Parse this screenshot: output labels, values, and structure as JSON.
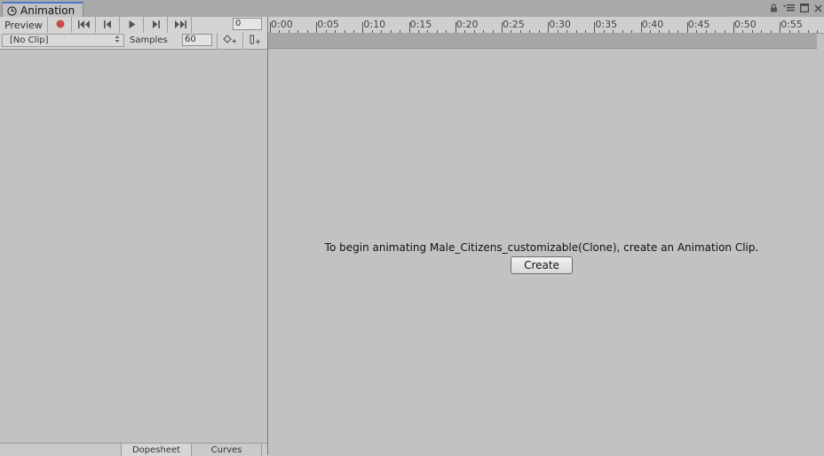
{
  "window": {
    "tab_title": "Animation"
  },
  "toolbar": {
    "preview_label": "Preview",
    "frame_value": "0",
    "clip_value": "[No Clip]",
    "samples_label": "Samples",
    "samples_value": "60"
  },
  "ruler": {
    "labels": [
      "0:00",
      "0:05",
      "0:10",
      "0:15",
      "0:20",
      "0:25",
      "0:30",
      "0:35",
      "0:40",
      "0:45",
      "0:50",
      "0:55"
    ]
  },
  "main": {
    "message": "To begin animating Male_Citizens_customizable(Clone), create an Animation Clip.",
    "create_label": "Create"
  },
  "bottom_tabs": {
    "dopesheet_label": "Dopesheet",
    "curves_label": "Curves"
  },
  "colors": {
    "record": "#c84c4c",
    "tab_accent": "#4a79c9"
  }
}
